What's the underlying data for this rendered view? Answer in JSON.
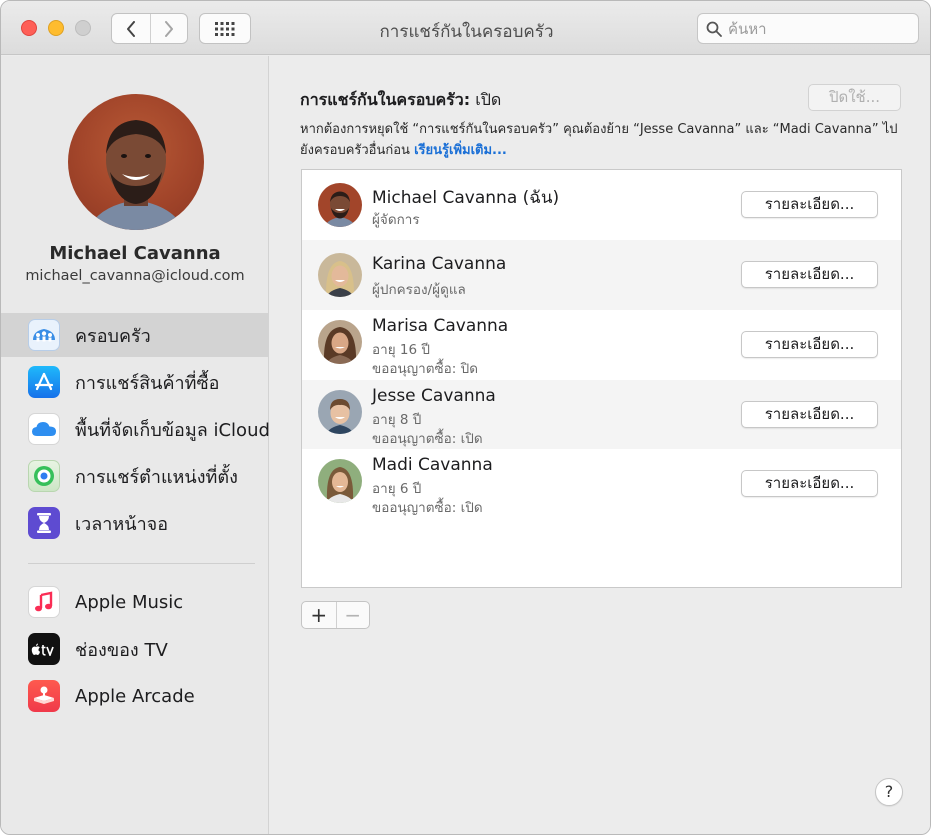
{
  "window": {
    "title": "การแชร์กันในครอบครัว"
  },
  "search": {
    "placeholder": "ค้นหา",
    "icon": "search-icon"
  },
  "sidebar": {
    "user_name": "Michael Cavanna",
    "user_email": "michael_cavanna@icloud.com",
    "items": [
      {
        "label": "ครอบครัว",
        "icon": "family-icon",
        "selected": true
      },
      {
        "label": "การแชร์สินค้าที่ซื้อ",
        "icon": "app-store-icon"
      },
      {
        "label": "พื้นที่จัดเก็บข้อมูล iCloud",
        "icon": "icloud-icon"
      },
      {
        "label": "การแชร์ตำแหน่งที่ตั้ง",
        "icon": "find-my-icon"
      },
      {
        "label": "เวลาหน้าจอ",
        "icon": "screen-time-icon"
      }
    ],
    "services": [
      {
        "label": "Apple Music",
        "icon": "music-icon"
      },
      {
        "label": "ช่องของ TV",
        "icon": "apple-tv-icon"
      },
      {
        "label": "Apple Arcade",
        "icon": "arcade-icon"
      }
    ]
  },
  "main": {
    "status_label": "การแชร์กันในครอบครัว:",
    "status_value": "เปิด",
    "disable_button": "ปิดใช้...",
    "info_text": "หากต้องการหยุดใช้ “การแชร์กันในครอบครัว” คุณต้องย้าย “Jesse Cavanna” และ “Madi Cavanna” ไปยังครอบครัวอื่นก่อน",
    "learn_more": "เรียนรู้เพิ่มเติม...",
    "members": [
      {
        "name": "Michael Cavanna (ฉัน)",
        "lines": [
          "ผู้จัดการ"
        ],
        "details": "รายละเอียด..."
      },
      {
        "name": "Karina Cavanna",
        "lines": [
          "ผู้ปกครอง/ผู้ดูแล"
        ],
        "details": "รายละเอียด..."
      },
      {
        "name": "Marisa Cavanna",
        "lines": [
          "อายุ 16 ปี",
          "ขออนุญาตซื้อ: ปิด"
        ],
        "details": "รายละเอียด..."
      },
      {
        "name": "Jesse Cavanna",
        "lines": [
          "อายุ 8 ปี",
          "ขออนุญาตซื้อ: เปิด"
        ],
        "details": "รายละเอียด..."
      },
      {
        "name": "Madi Cavanna",
        "lines": [
          "อายุ 6 ปี",
          "ขออนุญาตซื้อ: เปิด"
        ],
        "details": "รายละเอียด..."
      }
    ],
    "add_symbol": "+",
    "remove_symbol": "−",
    "help_symbol": "?"
  },
  "colors": {
    "accent_link": "#1a6fd6",
    "close": "#fe5f57",
    "minimize": "#febc2e"
  }
}
